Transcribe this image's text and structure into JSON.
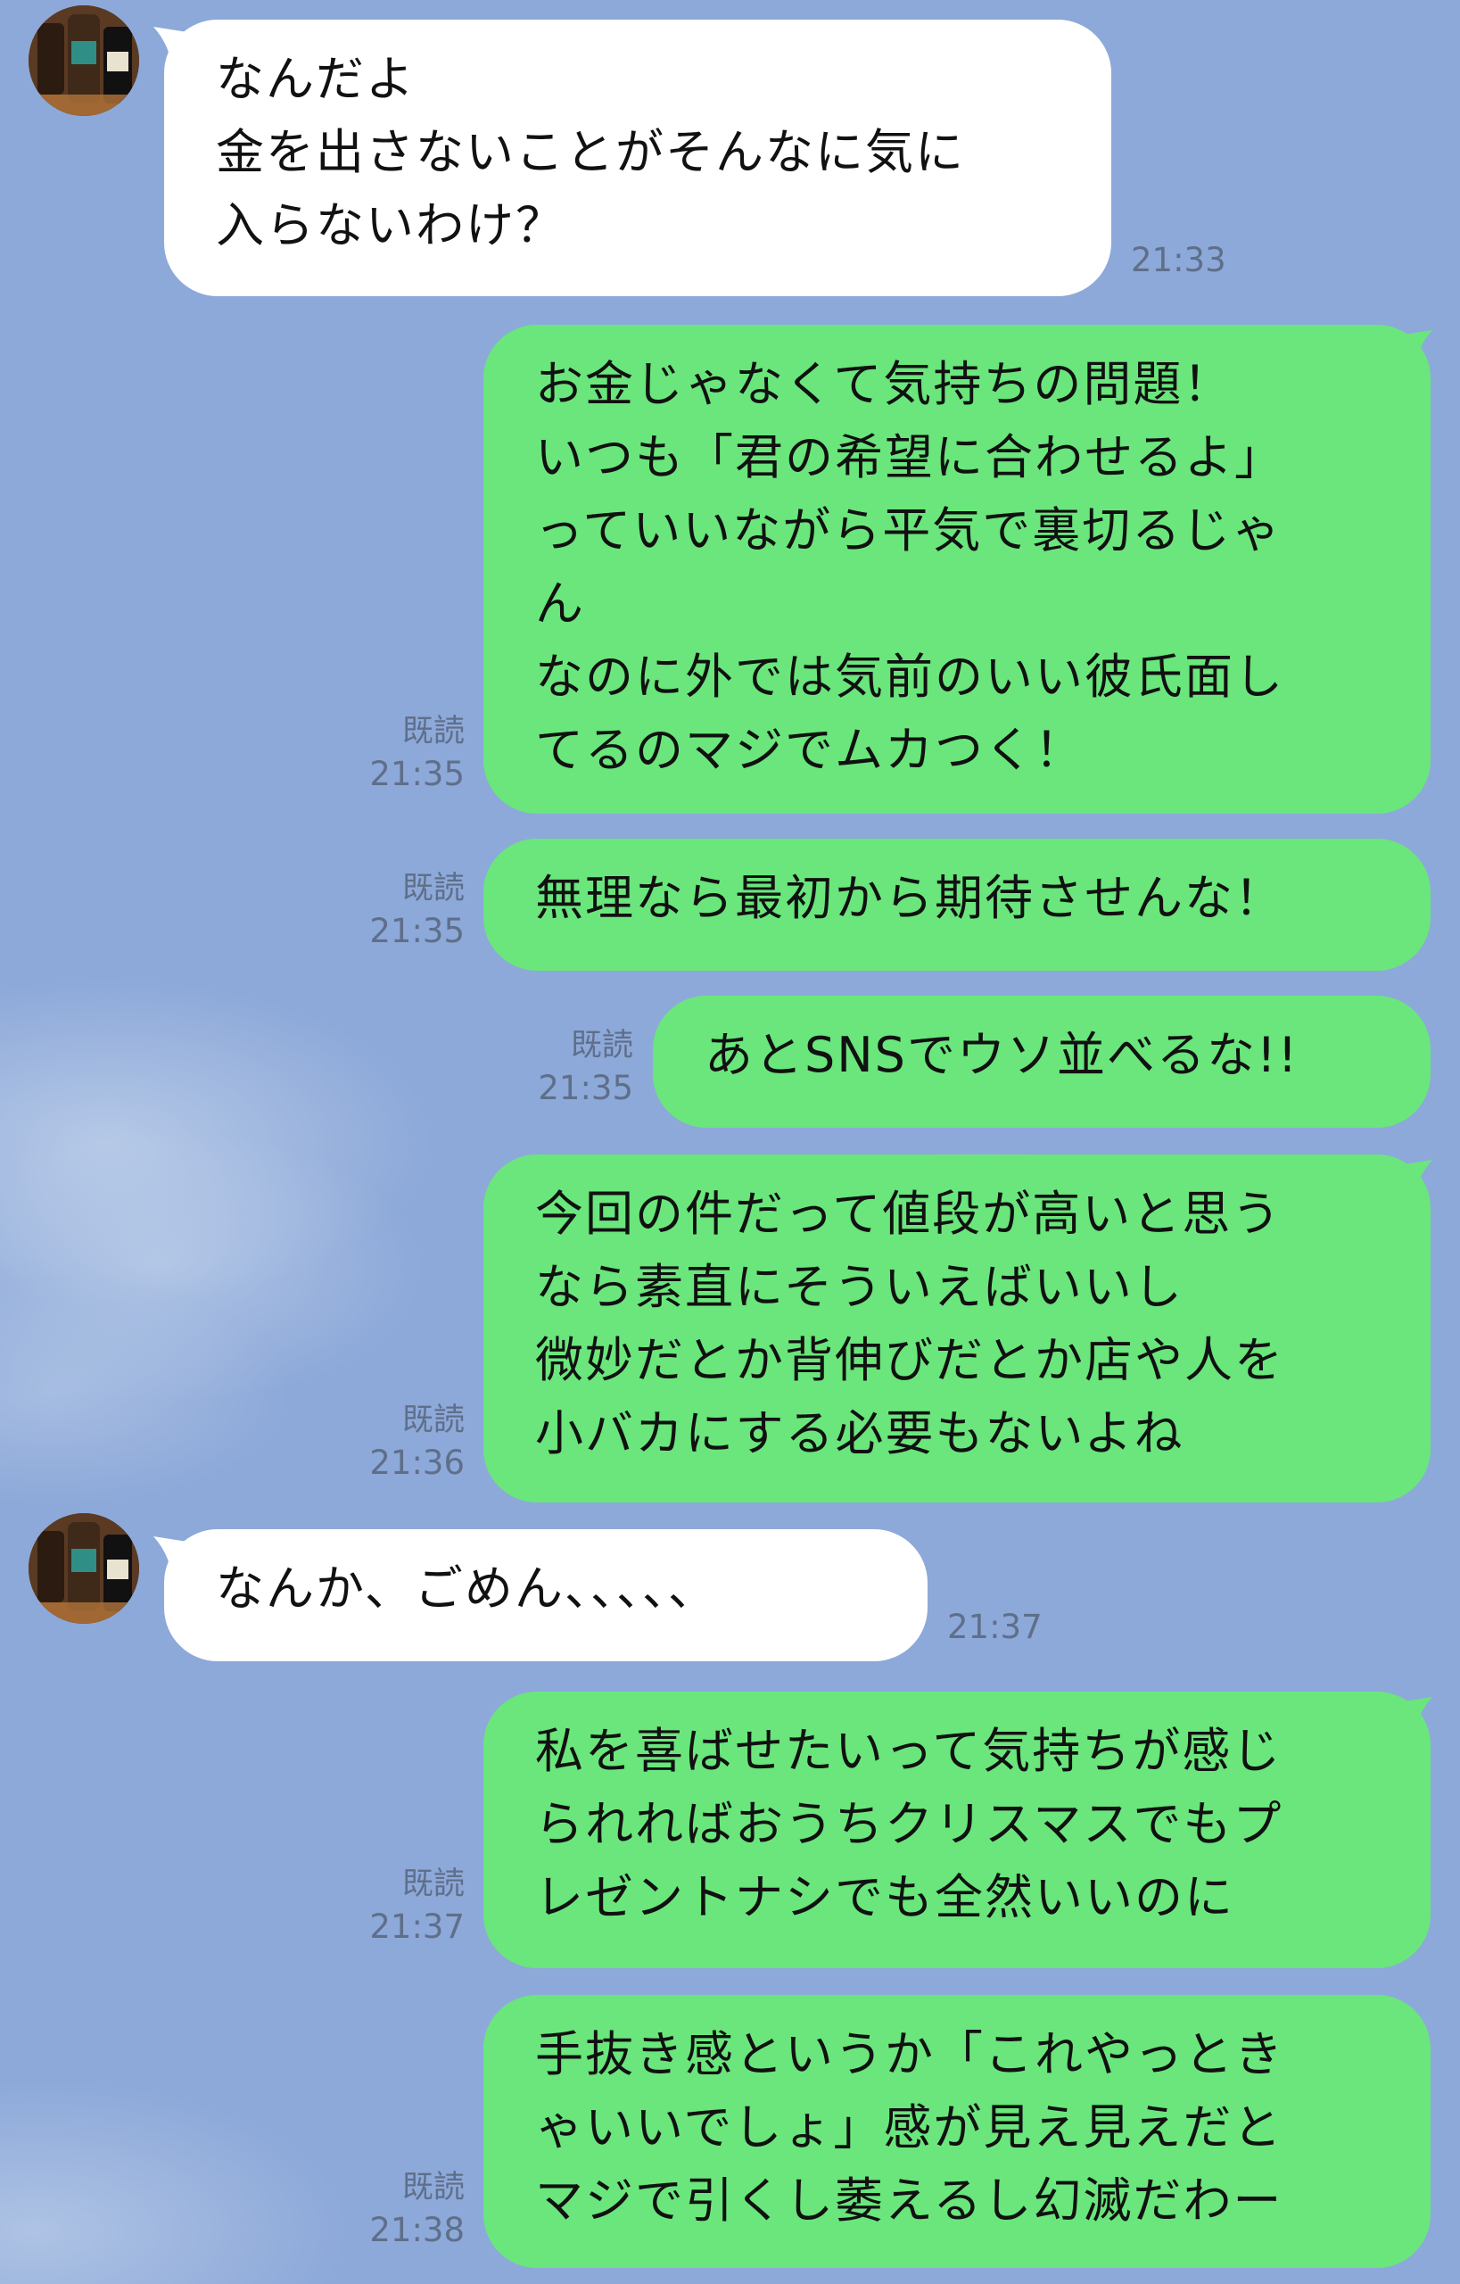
{
  "colors": {
    "background": "#8DA9D9",
    "incoming_bubble": "#FFFFFF",
    "outgoing_bubble": "#6AE67C",
    "meta_text": "#5F6F8A"
  },
  "messages": [
    {
      "side": "in",
      "icon": "avatar-icon",
      "text": "なんだよ\n金を出さないことがそんなに気に\n入らないわけ？",
      "time": "21:33"
    },
    {
      "side": "out",
      "read": "既読",
      "time": "21:35",
      "text": "お金じゃなくて気持ちの問題！\nいつも「君の希望に合わせるよ」\nっていいながら平気で裏切るじゃ\nん\nなのに外では気前のいい彼氏面し\nてるのマジでムカつく！"
    },
    {
      "side": "out",
      "read": "既読",
      "time": "21:35",
      "text": "無理なら最初から期待させんな！"
    },
    {
      "side": "out",
      "read": "既読",
      "time": "21:35",
      "text": "あとSNSでウソ並べるな!!"
    },
    {
      "side": "out",
      "read": "既読",
      "time": "21:36",
      "text": "今回の件だって値段が高いと思う\nなら素直にそういえばいいし\n微妙だとか背伸びだとか店や人を\n小バカにする必要もないよね"
    },
    {
      "side": "in",
      "icon": "avatar-icon",
      "text": "なんか、ごめん、、、、、",
      "time": "21:37"
    },
    {
      "side": "out",
      "read": "既読",
      "time": "21:37",
      "text": "私を喜ばせたいって気持ちが感じ\nられればおうちクリスマスでもプ\nレゼントナシでも全然いいのに"
    },
    {
      "side": "out",
      "read": "既読",
      "time": "21:38",
      "text": "手抜き感というか「これやっとき\nゃいいでしょ」感が見え見えだと\nマジで引くし萎えるし幻滅だわー"
    }
  ]
}
